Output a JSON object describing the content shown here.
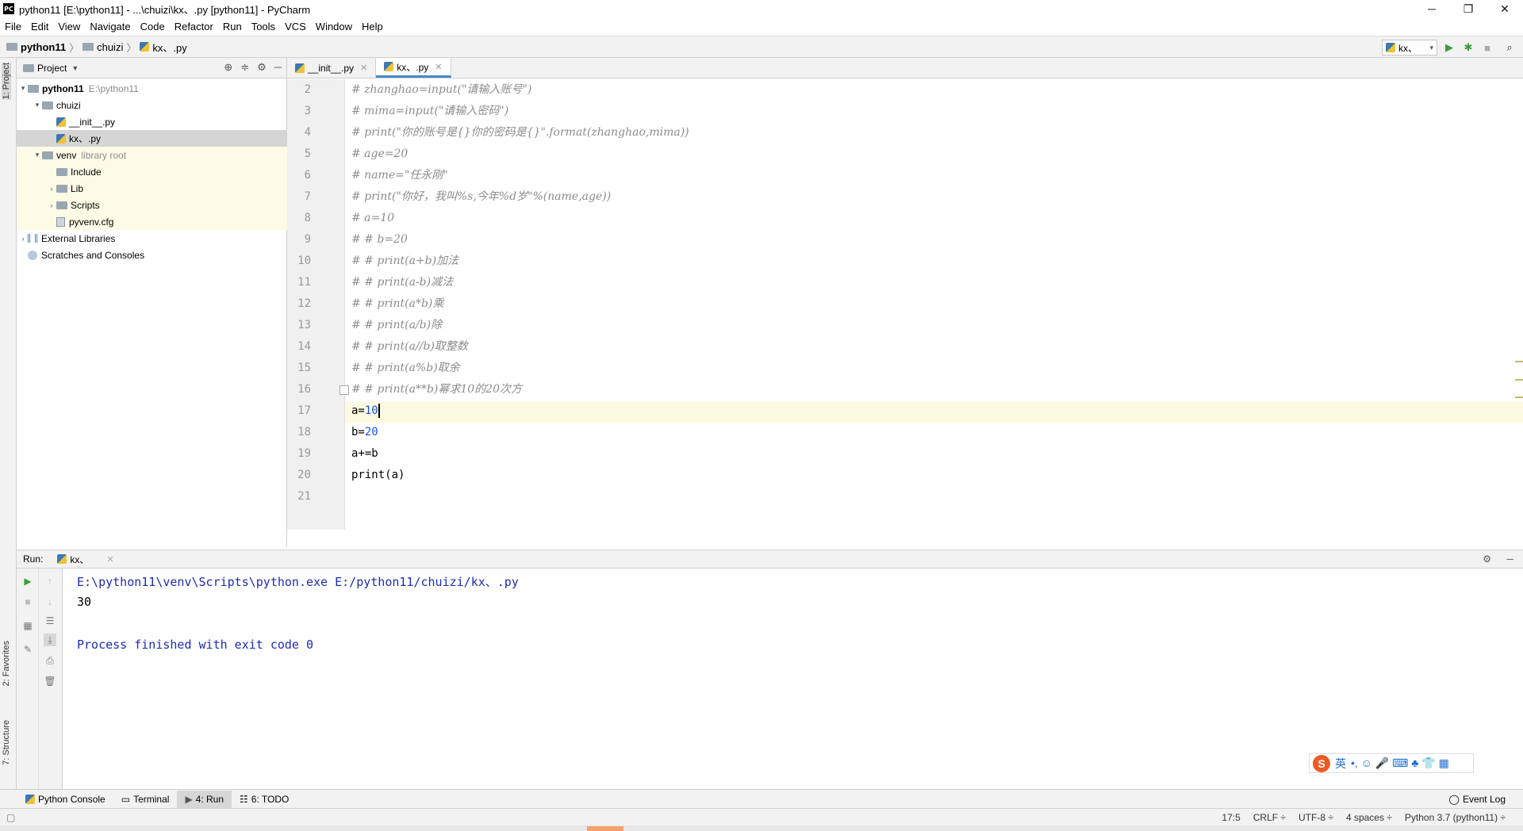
{
  "window": {
    "title": "python11 [E:\\python11] - ...\\chuizi\\kx、.py [python11] - PyCharm",
    "app_icon_text": "PC",
    "minimize": "─",
    "maximize": "❐",
    "close": "✕"
  },
  "menu": [
    "File",
    "Edit",
    "View",
    "Navigate",
    "Code",
    "Refactor",
    "Run",
    "Tools",
    "VCS",
    "Window",
    "Help"
  ],
  "breadcrumb": [
    "python11",
    "chuizi",
    "kx、.py"
  ],
  "run_config": "kx、",
  "left_strip": {
    "project_tab": "1: Project",
    "favorites_tab": "2: Favorites",
    "structure_tab": "7: Structure"
  },
  "project_panel": {
    "header": "Project",
    "tree": [
      {
        "label": "python11",
        "hint": "E:\\python11",
        "arrow": "▾"
      },
      {
        "label": "chuizi",
        "hint": "",
        "arrow": "▾"
      },
      {
        "label": "__init__.py",
        "hint": "",
        "arrow": ""
      },
      {
        "label": "kx、.py",
        "hint": "",
        "arrow": ""
      },
      {
        "label": "venv",
        "hint": "library root",
        "arrow": "▾"
      },
      {
        "label": "Include",
        "hint": "",
        "arrow": ""
      },
      {
        "label": "Lib",
        "hint": "",
        "arrow": "›"
      },
      {
        "label": "Scripts",
        "hint": "",
        "arrow": "›"
      },
      {
        "label": "pyvenv.cfg",
        "hint": "",
        "arrow": ""
      },
      {
        "label": "External Libraries",
        "hint": "",
        "arrow": "›"
      },
      {
        "label": "Scratches and Consoles",
        "hint": "",
        "arrow": ""
      }
    ]
  },
  "editor": {
    "tabs": [
      {
        "label": "__init__.py",
        "active": false
      },
      {
        "label": "kx、.py",
        "active": true
      }
    ],
    "lines": [
      {
        "n": "2",
        "text": "# zhanghao=input(\"请输入账号\")",
        "comment": true
      },
      {
        "n": "3",
        "text": "# mima=input(\"请输入密码\")",
        "comment": true
      },
      {
        "n": "4",
        "text": "# print(\"你的账号是{}你的密码是{}\".format(zhanghao,mima))",
        "comment": true
      },
      {
        "n": "5",
        "text": "# age=20",
        "comment": true
      },
      {
        "n": "6",
        "text": "# name=\"任永刚\"",
        "comment": true
      },
      {
        "n": "7",
        "text": "# print(\"你好，我叫%s,今年%d岁\"%(name,age))",
        "comment": true
      },
      {
        "n": "8",
        "text": "# a=10",
        "comment": true
      },
      {
        "n": "9",
        "text": "# # b=20",
        "comment": true
      },
      {
        "n": "10",
        "text": "# # print(a+b)加法",
        "comment": true
      },
      {
        "n": "11",
        "text": "# # print(a-b)减法",
        "comment": true
      },
      {
        "n": "12",
        "text": "# # print(a*b)乘",
        "comment": true
      },
      {
        "n": "13",
        "text": "# # print(a/b)除",
        "comment": true
      },
      {
        "n": "14",
        "text": "# # print(a//b)取整数",
        "comment": true
      },
      {
        "n": "15",
        "text": "# # print(a%b)取余",
        "comment": true
      },
      {
        "n": "16",
        "text": "# # print(a**b)幂求10的20次方",
        "comment": true
      },
      {
        "n": "17",
        "pre": "a=",
        "num": "10",
        "comment": false,
        "current": true
      },
      {
        "n": "18",
        "pre": "b=",
        "num": "20",
        "comment": false
      },
      {
        "n": "19",
        "text": "a+=b",
        "comment": false
      },
      {
        "n": "20",
        "text": "print(a)",
        "comment": false
      },
      {
        "n": "21",
        "text": "",
        "comment": false
      }
    ]
  },
  "run_panel": {
    "label": "Run:",
    "tab": "kx、",
    "output": [
      {
        "text": "E:\\python11\\venv\\Scripts\\python.exe E:/python11/chuizi/kx、.py",
        "blue": true
      },
      {
        "text": "30",
        "blue": false
      },
      {
        "text": "",
        "blue": false
      },
      {
        "text": "Process finished with exit code 0",
        "blue": true
      }
    ]
  },
  "bottom_tools": [
    "Python Console",
    "Terminal",
    "4: Run",
    "6: TODO"
  ],
  "event_log": "Event Log",
  "status": {
    "position": "17:5",
    "line_sep": "CRLF ÷",
    "encoding": "UTF-8 ÷",
    "indent": "4 spaces ÷",
    "interpreter": "Python 3.7 (python11) ÷"
  },
  "ime": {
    "logo": "S",
    "mode": "英",
    "icons": "•, ☺ 🎤 ⌨ ♣ 👕 ▦"
  },
  "colors": {
    "accent": "#4a88c7",
    "number": "#1750eb",
    "comment": "#8c8c8c",
    "console_blue": "#1d2bb5",
    "current_line": "#fcfae1"
  }
}
